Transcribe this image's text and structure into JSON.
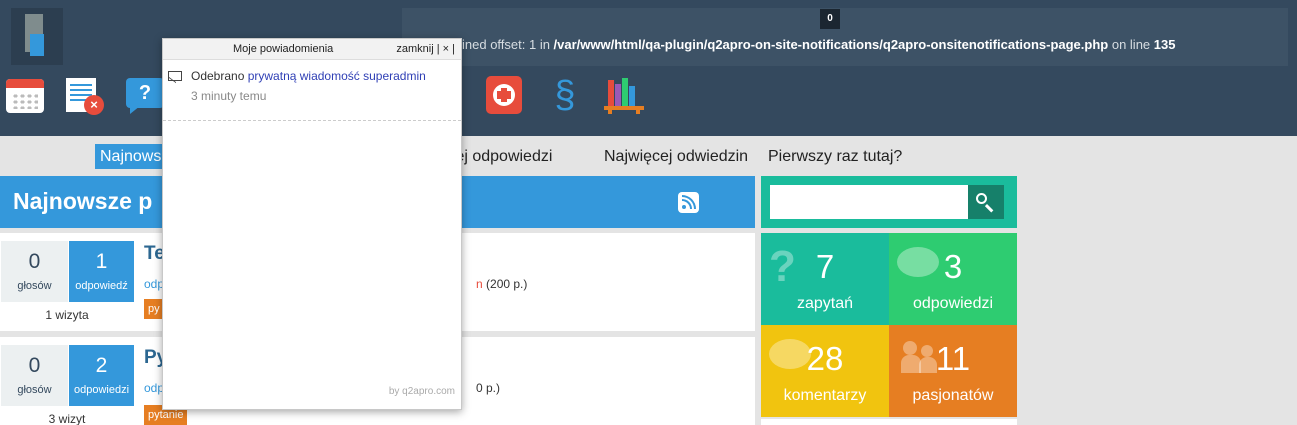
{
  "header": {
    "error": {
      "count": "0",
      "prefix": "ined offset: 1 in ",
      "path": "/var/www/html/qa-plugin/q2apro-on-site-notifications/q2apro-onsitenotifications-page.php",
      "middle": " on line ",
      "line": "135"
    },
    "icons": [
      "calendar-icon",
      "list-remove-icon",
      "help-icon",
      "first-aid-icon",
      "section-icon",
      "books-icon"
    ],
    "section_symbol": "§"
  },
  "nav": {
    "items": [
      "Najnows",
      "ięcej odpowiedzi",
      "Najwięcej odwiedzin",
      "Pierwszy raz tutaj?"
    ]
  },
  "main": {
    "title": "Najnowsze p",
    "questions": [
      {
        "votes": "0",
        "votes_label": "głosów",
        "answers": "1",
        "answers_label": "odpowiedź",
        "views": "1 wizyta",
        "title": "Te",
        "meta": "odp",
        "user_suffix": "n",
        "points": "(200 p.)",
        "tag": "py"
      },
      {
        "votes": "0",
        "votes_label": "głosów",
        "answers": "2",
        "answers_label": "odpowiedzi",
        "views": "3 wizyt",
        "title": "Py",
        "meta": "odp",
        "points": "0 p.)",
        "tag": "pytanie"
      }
    ]
  },
  "sidebar": {
    "search_placeholder": "",
    "stats": [
      {
        "num": "7",
        "label": "zapytań"
      },
      {
        "num": "3",
        "label": "odpowiedzi"
      },
      {
        "num": "28",
        "label": "komentarzy"
      },
      {
        "num": "11",
        "label": "pasjonatów"
      }
    ]
  },
  "notifications": {
    "title": "Moje powiadomienia",
    "close": "zamknij | × |",
    "item": {
      "text": "Odebrano ",
      "link": "prywatną wiadomość superadmin",
      "time": "3 minuty temu"
    },
    "footer": "by q2apro.com"
  },
  "colors": {
    "header_bg": "#34495e",
    "accent_blue": "#3498db",
    "teal": "#1abc9c",
    "green": "#2ecc71",
    "yellow": "#f1c40f",
    "orange": "#e67e22",
    "red": "#e74c3c"
  }
}
